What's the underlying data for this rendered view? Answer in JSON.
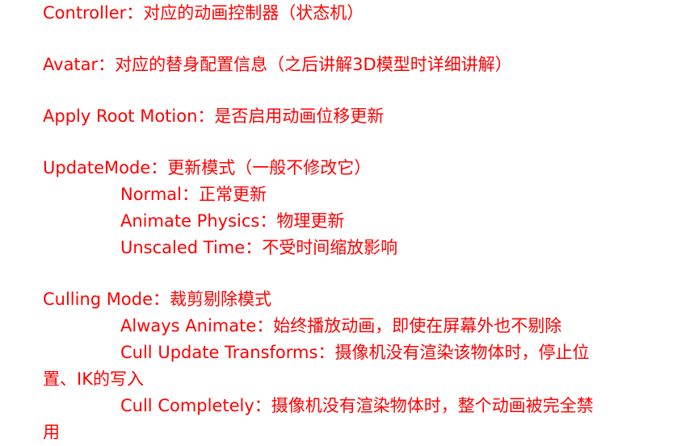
{
  "colors": {
    "text": "#ff0000",
    "background": "#ffffff"
  },
  "lines": {
    "controller": "Controller：对应的动画控制器（状态机）",
    "avatar": "Avatar：对应的替身配置信息（之后讲解3D模型时详细讲解）",
    "apply_root_motion": "Apply Root Motion：是否启用动画位移更新",
    "update_mode": "UpdateMode：更新模式（一般不修改它）",
    "update_normal": "Normal：正常更新",
    "update_animate_physics": "Animate Physics：物理更新",
    "update_unscaled_time": "Unscaled Time：不受时间缩放影响",
    "culling_mode": "Culling Mode：裁剪剔除模式",
    "culling_always_animate": "Always Animate：始终播放动画，即使在屏幕外也不剔除",
    "culling_cull_update_transforms_1": "Cull Update Transforms：摄像机没有渲染该物体时，停止位",
    "culling_cull_update_transforms_2": "置、IK的写入",
    "culling_cull_completely_1": "Cull Completely：摄像机没有渲染物体时，整个动画被完全禁",
    "culling_cull_completely_2": "用"
  }
}
